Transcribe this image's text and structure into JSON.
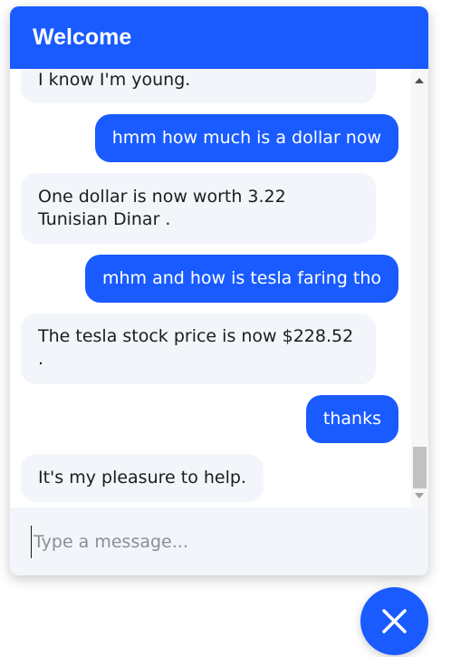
{
  "header": {
    "title": "Welcome"
  },
  "messages": [
    {
      "from": "bot",
      "text": "I know I'm young."
    },
    {
      "from": "user",
      "text": "hmm how much is a dollar now"
    },
    {
      "from": "bot",
      "text": "One dollar is now worth 3.22 Tunisian Dinar ."
    },
    {
      "from": "user",
      "text": "mhm and how is tesla faring tho"
    },
    {
      "from": "bot",
      "text": "The tesla stock price is now $228.52 ."
    },
    {
      "from": "user",
      "text": "thanks"
    },
    {
      "from": "bot",
      "text": "It's my pleasure to help."
    }
  ],
  "composer": {
    "placeholder": "Type a message...",
    "value": ""
  },
  "colors": {
    "accent": "#1a5bff",
    "bot_bubble": "#f2f5f9",
    "composer_bg": "#f2f5f9"
  },
  "icons": {
    "close_button": "close-icon"
  }
}
